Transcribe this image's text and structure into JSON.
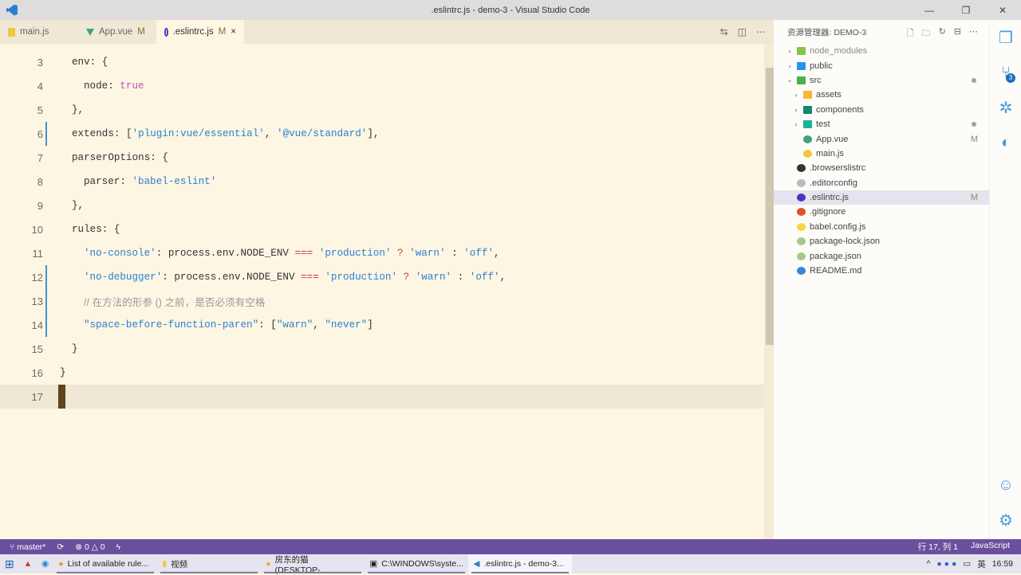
{
  "window": {
    "title": ".eslintrc.js - demo-3 - Visual Studio Code"
  },
  "tabs": [
    {
      "label": "main.js",
      "icon": "js-icon",
      "badge": ""
    },
    {
      "label": "App.vue",
      "icon": "vue-icon",
      "badge": "M"
    },
    {
      "label": ".eslintrc.js",
      "icon": "eslint-icon",
      "badge": "M",
      "close": "×"
    }
  ],
  "editor": {
    "lines": [
      {
        "n": "3",
        "indent": 1,
        "tokens": [
          [
            "k",
            "env: {"
          ]
        ]
      },
      {
        "n": "4",
        "indent": 2,
        "tokens": [
          [
            "k",
            "node: "
          ],
          [
            "b",
            "true"
          ]
        ]
      },
      {
        "n": "5",
        "indent": 1,
        "tokens": [
          [
            "k",
            "},"
          ]
        ]
      },
      {
        "n": "6",
        "indent": 1,
        "tokens": [
          [
            "k",
            "extends: ["
          ],
          [
            "s",
            "'plugin:vue/essential'"
          ],
          [
            "k",
            ", "
          ],
          [
            "s",
            "'@vue/standard'"
          ],
          [
            "k",
            "],"
          ]
        ]
      },
      {
        "n": "7",
        "indent": 1,
        "tokens": [
          [
            "k",
            "parserOptions: {"
          ]
        ]
      },
      {
        "n": "8",
        "indent": 2,
        "tokens": [
          [
            "k",
            "parser: "
          ],
          [
            "s",
            "'babel-eslint'"
          ]
        ]
      },
      {
        "n": "9",
        "indent": 1,
        "tokens": [
          [
            "k",
            "},"
          ]
        ]
      },
      {
        "n": "10",
        "indent": 1,
        "tokens": [
          [
            "k",
            "rules: {"
          ]
        ]
      },
      {
        "n": "11",
        "indent": 2,
        "tokens": [
          [
            "s",
            "'no-console'"
          ],
          [
            "k",
            ": process.env.NODE_ENV "
          ],
          [
            "o",
            "==="
          ],
          [
            "k",
            " "
          ],
          [
            "s",
            "'production'"
          ],
          [
            "k",
            " "
          ],
          [
            "o",
            "?"
          ],
          [
            "k",
            " "
          ],
          [
            "s",
            "'warn'"
          ],
          [
            "k",
            " : "
          ],
          [
            "s",
            "'off'"
          ],
          [
            "k",
            ","
          ]
        ]
      },
      {
        "n": "12",
        "indent": 2,
        "tokens": [
          [
            "s",
            "'no-debugger'"
          ],
          [
            "k",
            ": process.env.NODE_ENV "
          ],
          [
            "o",
            "==="
          ],
          [
            "k",
            " "
          ],
          [
            "s",
            "'production'"
          ],
          [
            "k",
            " "
          ],
          [
            "o",
            "?"
          ],
          [
            "k",
            " "
          ],
          [
            "s",
            "'warn'"
          ],
          [
            "k",
            " : "
          ],
          [
            "s",
            "'off'"
          ],
          [
            "k",
            ","
          ]
        ]
      },
      {
        "n": "13",
        "indent": 2,
        "tokens": [
          [
            "c",
            "// 在方法的形参 () 之前，是否必须有空格"
          ]
        ]
      },
      {
        "n": "14",
        "indent": 2,
        "tokens": [
          [
            "s",
            "\"space-before-function-paren\""
          ],
          [
            "k",
            ": ["
          ],
          [
            "s",
            "\"warn\""
          ],
          [
            "k",
            ", "
          ],
          [
            "s",
            "\"never\""
          ],
          [
            "k",
            "]"
          ]
        ]
      },
      {
        "n": "15",
        "indent": 1,
        "tokens": [
          [
            "k",
            "}"
          ]
        ]
      },
      {
        "n": "16",
        "indent": 0,
        "tokens": [
          [
            "k",
            "}"
          ]
        ]
      },
      {
        "n": "17",
        "indent": 0,
        "tokens": []
      }
    ]
  },
  "explorer": {
    "title": "资源管理器: DEMO-3",
    "items": [
      {
        "label": "node_modules",
        "depth": 0,
        "chev": "›",
        "color": "#8bc34a",
        "muted": true
      },
      {
        "label": "public",
        "depth": 0,
        "chev": "›",
        "color": "#2196f3"
      },
      {
        "label": "src",
        "depth": 0,
        "chev": "⌄",
        "color": "#4caf50",
        "dot": true
      },
      {
        "label": "assets",
        "depth": 1,
        "chev": "›",
        "color": "#f5b82e"
      },
      {
        "label": "components",
        "depth": 1,
        "chev": "›",
        "color": "#0f8a6a"
      },
      {
        "label": "test",
        "depth": 1,
        "chev": "›",
        "color": "#1ab394",
        "dot": true
      },
      {
        "label": "App.vue",
        "depth": 1,
        "chev": "",
        "color": "#3fa47a",
        "badge": "M"
      },
      {
        "label": "main.js",
        "depth": 1,
        "chev": "",
        "color": "#f0c840"
      },
      {
        "label": ".browserslistrc",
        "depth": 0,
        "chev": "",
        "color": "#333"
      },
      {
        "label": ".editorconfig",
        "depth": 0,
        "chev": "",
        "color": "#bbb"
      },
      {
        "label": ".eslintrc.js",
        "depth": 0,
        "chev": "",
        "color": "#4b32c3",
        "badge": "M",
        "selected": true
      },
      {
        "label": ".gitignore",
        "depth": 0,
        "chev": "",
        "color": "#e0502a"
      },
      {
        "label": "babel.config.js",
        "depth": 0,
        "chev": "",
        "color": "#f5d742"
      },
      {
        "label": "package-lock.json",
        "depth": 0,
        "chev": "",
        "color": "#a8c88a"
      },
      {
        "label": "package.json",
        "depth": 0,
        "chev": "",
        "color": "#a8c88a"
      },
      {
        "label": "README.md",
        "depth": 0,
        "chev": "",
        "color": "#3a86d8"
      }
    ]
  },
  "activity": {
    "scm_badge": "3"
  },
  "status": {
    "branch": "master*",
    "errors": "0",
    "warnings": "0",
    "position": "行 17, 列 1",
    "language": "JavaScript"
  },
  "taskbar": {
    "apps": [
      "List of available rule...",
      "视频",
      "房东的猫(DESKTOP-...",
      "C:\\WINDOWS\\syste...",
      ".eslintrc.js - demo-3..."
    ],
    "ime": "英",
    "time": "16:59"
  }
}
